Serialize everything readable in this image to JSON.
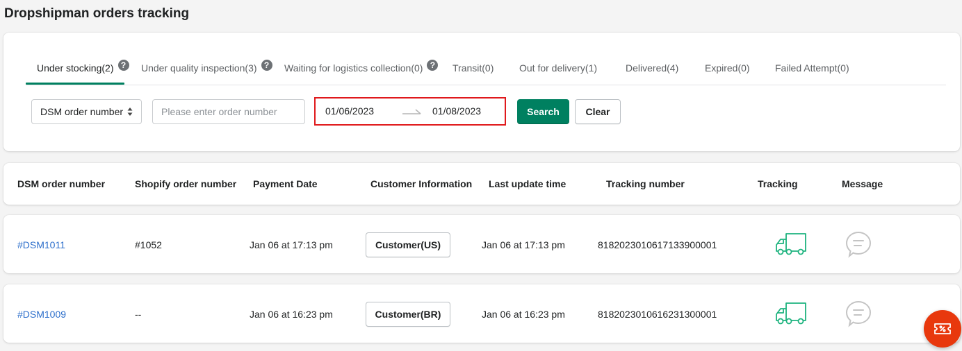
{
  "page": {
    "title": "Dropshipman orders tracking"
  },
  "tabs": [
    {
      "label": "Under stocking(2)",
      "has_help": true,
      "active": true
    },
    {
      "label": "Under quality inspection(3)",
      "has_help": true,
      "active": false
    },
    {
      "label": "Waiting for logistics collection(0)",
      "has_help": true,
      "active": false
    },
    {
      "label": "Transit(0)",
      "has_help": false,
      "active": false
    },
    {
      "label": "Out for delivery(1)",
      "has_help": false,
      "active": false
    },
    {
      "label": "Delivered(4)",
      "has_help": false,
      "active": false
    },
    {
      "label": "Expired(0)",
      "has_help": false,
      "active": false
    },
    {
      "label": "Failed Attempt(0)",
      "has_help": false,
      "active": false
    }
  ],
  "help_glyph": "?",
  "filters": {
    "select_value": "DSM order number",
    "order_input": {
      "value": "",
      "placeholder": "Please enter order number"
    },
    "date_start": "01/06/2023",
    "date_end": "01/08/2023",
    "search_label": "Search",
    "clear_label": "Clear"
  },
  "table": {
    "columns": [
      "DSM order number",
      "Shopify order number",
      "Payment Date",
      "Customer Information",
      "Last update time",
      "Tracking number",
      "Tracking",
      "Message"
    ],
    "rows": [
      {
        "dsm_order": "#DSM1011",
        "shopify_order": "#1052",
        "payment_date": "Jan 06 at 17:13 pm",
        "customer": "Customer(US)",
        "last_update": "Jan 06 at 17:13 pm",
        "tracking_number": "818202301061713390000​1"
      },
      {
        "dsm_order": "#DSM1009",
        "shopify_order": "--",
        "payment_date": "Jan 06 at 16:23 pm",
        "customer": "Customer(BR)",
        "last_update": "Jan 06 at 16:23 pm",
        "tracking_number": "818202301061623130000​1"
      }
    ]
  },
  "icons": {
    "tracking": "truck-icon",
    "message": "chat-bubble-icon",
    "fab": "coupon-ticket-icon"
  },
  "colors": {
    "primary": "#008060",
    "link": "#2c6ecb",
    "highlight_border": "#e0191c",
    "truck": "#1db37e",
    "message_icon": "#c4c4c4",
    "fab": "#e8380d"
  }
}
